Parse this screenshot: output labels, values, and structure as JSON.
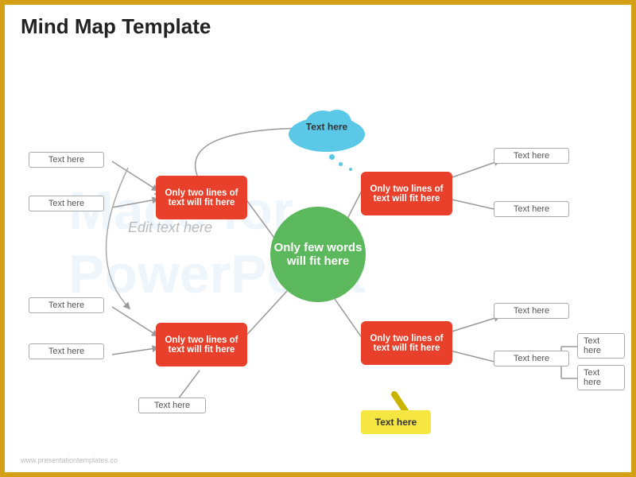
{
  "title": "Mind Map Template",
  "watermark_line1": "Made for",
  "watermark_line2": "PowerPoint",
  "center_circle_text": "Only few words will fit here",
  "edit_text": "Edit text here",
  "cloud_text": "Text here",
  "yellow_box_text": "Text here",
  "red_boxes": [
    {
      "id": "rb1",
      "text": "Only two lines of text will fit here"
    },
    {
      "id": "rb2",
      "text": "Only two lines of text will fit here"
    },
    {
      "id": "rb3",
      "text": "Only two lines of text will fit here"
    },
    {
      "id": "rb4",
      "text": "Only two lines of text will fit here"
    }
  ],
  "small_boxes": [
    {
      "id": "sb1",
      "text": "Text here"
    },
    {
      "id": "sb2",
      "text": "Text here"
    },
    {
      "id": "sb3",
      "text": "Text here"
    },
    {
      "id": "sb4",
      "text": "Text here"
    },
    {
      "id": "sb5",
      "text": "Text here"
    },
    {
      "id": "sb6",
      "text": "Text here"
    },
    {
      "id": "sb7",
      "text": "Text here"
    },
    {
      "id": "sb8",
      "text": "Text here"
    },
    {
      "id": "sb9",
      "text": "Text here"
    },
    {
      "id": "sb10",
      "text": "Text here"
    },
    {
      "id": "sb11",
      "text": "Text here"
    }
  ],
  "footer": "www.presentationtemplates.co"
}
